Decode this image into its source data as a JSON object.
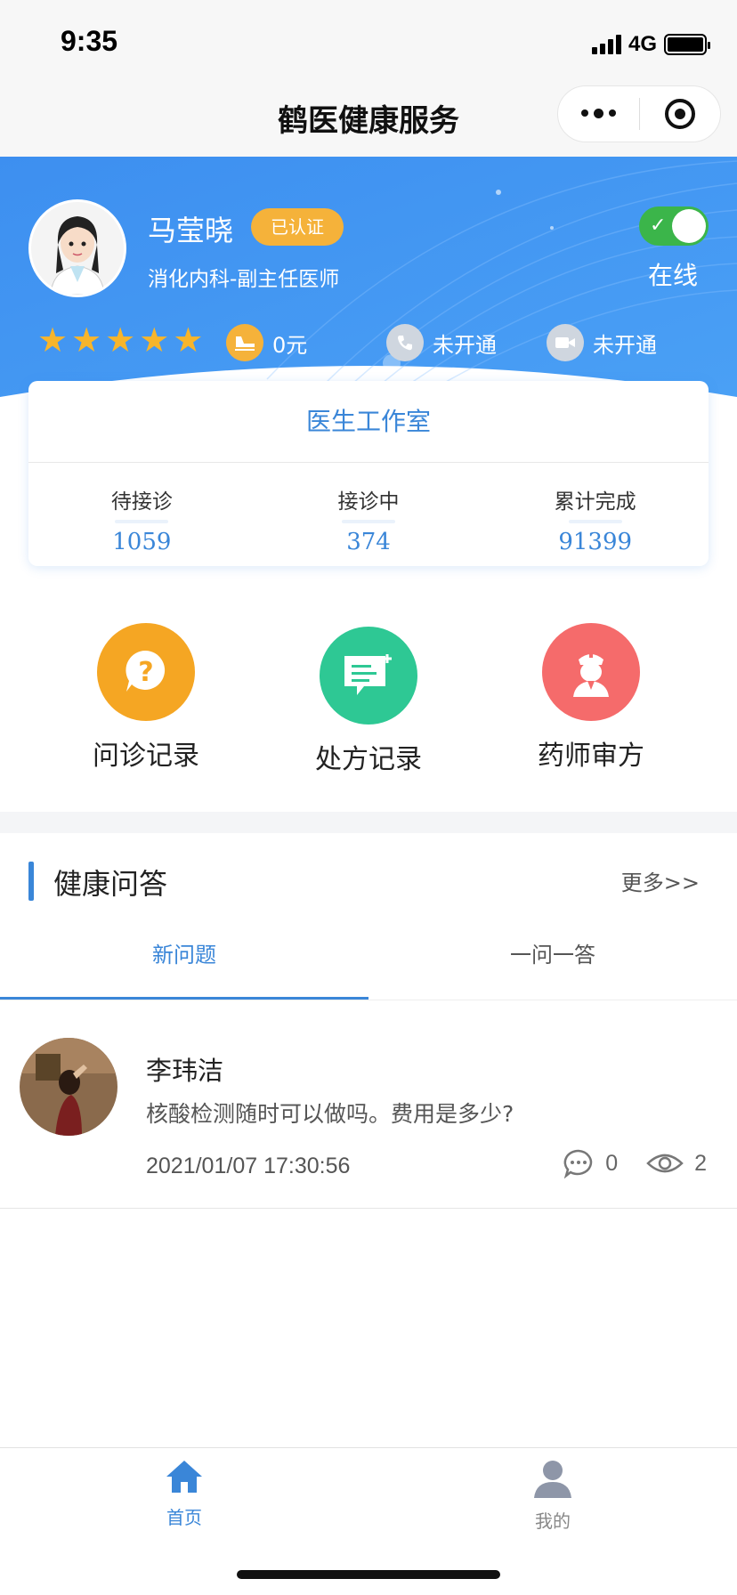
{
  "status": {
    "time": "9:35",
    "network": "4G"
  },
  "navbar": {
    "title": "鹤医健康服务"
  },
  "doctor": {
    "name": "马莹晓",
    "badge": "已认证",
    "department": "消化内科-副主任医师",
    "online_label": "在线",
    "rating_stars": 5,
    "fee": "0元",
    "phone_status": "未开通",
    "video_status": "未开通"
  },
  "studio": {
    "title": "医生工作室",
    "stats": [
      {
        "label": "待接诊",
        "value": "1059"
      },
      {
        "label": "接诊中",
        "value": "374"
      },
      {
        "label": "累计完成",
        "value": "91399"
      }
    ]
  },
  "shortcuts": [
    {
      "label": "问诊记录",
      "icon": "question-bubble-icon",
      "color": "#f5a623"
    },
    {
      "label": "处方记录",
      "icon": "prescription-icon",
      "color": "#2ec894"
    },
    {
      "label": "药师审方",
      "icon": "pharmacist-icon",
      "color": "#f56b6b"
    }
  ],
  "qa": {
    "title": "健康问答",
    "more": "更多>>",
    "tabs": [
      "新问题",
      "一问一答"
    ],
    "items": [
      {
        "name": "李玮洁",
        "question": "核酸检测随时可以做吗。费用是多少?",
        "time": "2021/01/07 17:30:56",
        "comments": "0",
        "views": "2"
      }
    ]
  },
  "tabbar": {
    "items": [
      {
        "label": "首页",
        "icon": "home-icon"
      },
      {
        "label": "我的",
        "icon": "user-icon"
      }
    ]
  },
  "colors": {
    "primary": "#3a86d8",
    "hero": "#3d8ff0",
    "gold": "#f5b23a",
    "online": "#3bb54a"
  }
}
